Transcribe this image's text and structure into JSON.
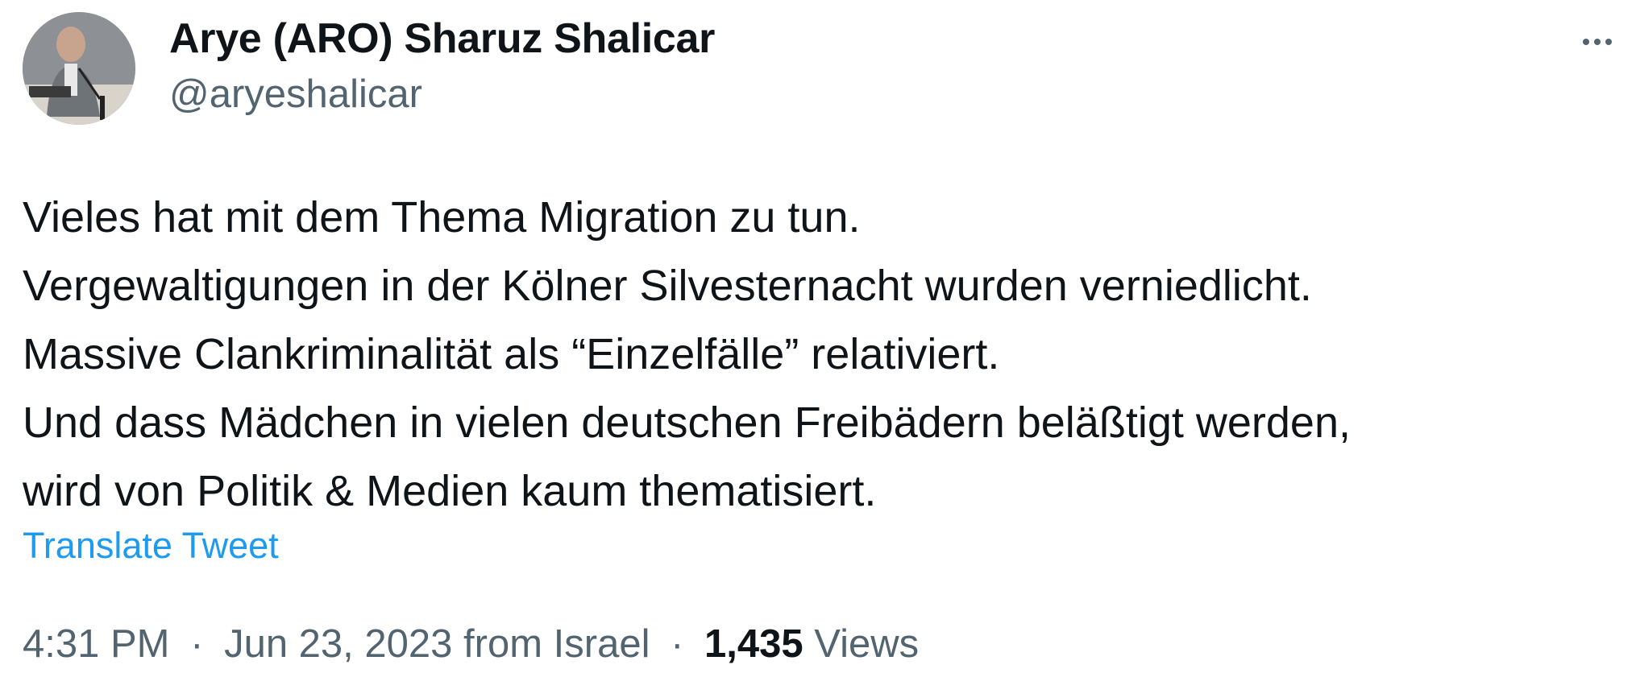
{
  "author": {
    "name": "Arye (ARO) Sharuz Shalicar",
    "handle": "@aryeshalicar"
  },
  "tweet": {
    "lines": [
      "Vieles hat mit dem Thema Migration zu tun.",
      "Vergewaltigungen in der Kölner Silvesternacht wurden verniedlicht.",
      "Massive Clankriminalität als “Einzelfälle” relativiert.",
      "Und dass Mädchen in vielen deutschen Freibädern beläßtigt werden,",
      "wird von Politik & Medien kaum thematisiert."
    ],
    "translate_label": "Translate Tweet"
  },
  "meta": {
    "time": "4:31 PM",
    "separator": "·",
    "date_location": "Jun 23, 2023 from Israel",
    "views_count": "1,435",
    "views_label": "Views"
  },
  "icons": {
    "more": "more-dots-icon"
  },
  "colors": {
    "text": "#0f1419",
    "secondary": "#536471",
    "link": "#1d9bf0",
    "background": "#ffffff"
  }
}
